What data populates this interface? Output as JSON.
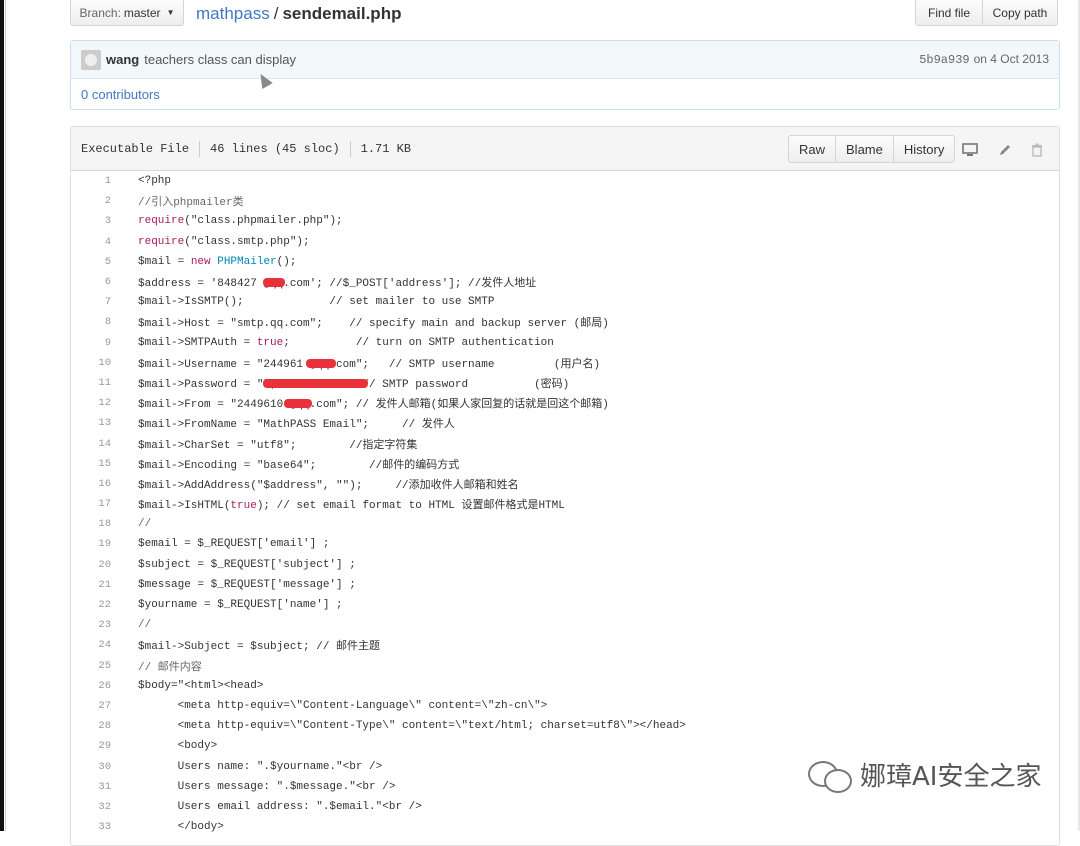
{
  "header": {
    "branch_prefix": "Branch:",
    "branch_name": "master",
    "repo": "mathpass",
    "separator": "/",
    "filename": "sendemail.php",
    "find_file": "Find file",
    "copy_path": "Copy path"
  },
  "commit": {
    "author": "wang",
    "message": "teachers class can display",
    "sha": "5b9a939",
    "date": "on 4 Oct 2013",
    "contributors": "0 contributors"
  },
  "file": {
    "type": "Executable File",
    "lines": "46 lines (45 sloc)",
    "size": "1.71 KB",
    "raw": "Raw",
    "blame": "Blame",
    "history": "History",
    "icons": [
      "desktop-icon",
      "pencil-icon",
      "trash-icon"
    ]
  },
  "code": [
    {
      "n": "1",
      "t": "<?php"
    },
    {
      "n": "2",
      "t": "//引入phpmailer类"
    },
    {
      "n": "3",
      "t": "require(\"class.phpmailer.php\");"
    },
    {
      "n": "4",
      "t": "require(\"class.smtp.php\");"
    },
    {
      "n": "5",
      "t": "$mail = new PHPMailer();"
    },
    {
      "n": "6",
      "t": "$address = '848427 @qq.com'; //$_POST['address']; //发件人地址"
    },
    {
      "n": "7",
      "t": "$mail->IsSMTP();             // set mailer to use SMTP"
    },
    {
      "n": "8",
      "t": "$mail->Host = \"smtp.qq.com\";    // specify main and backup server (邮局)"
    },
    {
      "n": "9",
      "t": "$mail->SMTPAuth = true;          // turn on SMTP authentication"
    },
    {
      "n": "10",
      "t": "$mail->Username = \"244961 @qq.com\";   // SMTP username         (用户名)"
    },
    {
      "n": "11",
      "t": "$mail->Password = \"\";             // SMTP password          (密码)"
    },
    {
      "n": "12",
      "t": "$mail->From = \"2449610 @qq.com\"; // 发件人邮箱(如果人家回复的话就是回这个邮箱)"
    },
    {
      "n": "13",
      "t": "$mail->FromName = \"MathPASS Email\";     // 发件人"
    },
    {
      "n": "14",
      "t": "$mail->CharSet = \"utf8\";        //指定字符集"
    },
    {
      "n": "15",
      "t": "$mail->Encoding = \"base64\";        //邮件的编码方式"
    },
    {
      "n": "16",
      "t": "$mail->AddAddress(\"$address\", \"\");     //添加收件人邮箱和姓名"
    },
    {
      "n": "17",
      "t": "$mail->IsHTML(true); // set email format to HTML 设置邮件格式是HTML"
    },
    {
      "n": "18",
      "t": "//"
    },
    {
      "n": "19",
      "t": "$email = $_REQUEST['email'] ;"
    },
    {
      "n": "20",
      "t": "$subject = $_REQUEST['subject'] ;"
    },
    {
      "n": "21",
      "t": "$message = $_REQUEST['message'] ;"
    },
    {
      "n": "22",
      "t": "$yourname = $_REQUEST['name'] ;"
    },
    {
      "n": "23",
      "t": "//"
    },
    {
      "n": "24",
      "t": "$mail->Subject = $subject; // 邮件主题"
    },
    {
      "n": "25",
      "t": "// 邮件内容"
    },
    {
      "n": "26",
      "t": "$body=\"<html><head>"
    },
    {
      "n": "27",
      "t": "      <meta http-equiv=\\\"Content-Language\\\" content=\\\"zh-cn\\\">"
    },
    {
      "n": "28",
      "t": "      <meta http-equiv=\\\"Content-Type\\\" content=\\\"text/html; charset=utf8\\\"></head>"
    },
    {
      "n": "29",
      "t": "      <body>"
    },
    {
      "n": "30",
      "t": "      Users name: \".$yourname.\"<br />"
    },
    {
      "n": "31",
      "t": "      Users message: \".$message.\"<br />"
    },
    {
      "n": "32",
      "t": "      Users email address: \".$email.\"<br />"
    },
    {
      "n": "33",
      "t": "      </body>"
    }
  ],
  "watermark": "娜璋AI安全之家"
}
